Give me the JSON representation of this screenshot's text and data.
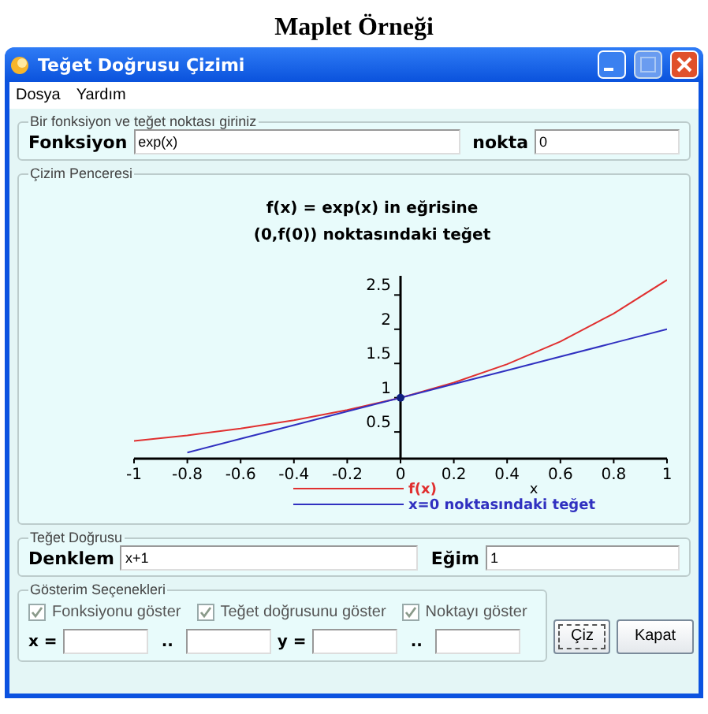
{
  "page_title": "Maplet Örneği",
  "window": {
    "title": "Teğet Doğrusu Çizimi"
  },
  "menu": [
    "Dosya",
    "Yardım"
  ],
  "input_group": {
    "title": "Bir fonksiyon ve teğet noktası  giriniz",
    "fields": [
      {
        "label": "Fonksiyon",
        "value": "exp(x)"
      },
      {
        "label": "nokta",
        "value": "0"
      }
    ]
  },
  "plot_group": {
    "title": "Çizim Penceresi",
    "chart_data": {
      "type": "line",
      "title": "f(x) = exp(x) in eğrisine\n(0,f(0)) noktasındaki teğet",
      "xlabel": "x",
      "x": [
        -1,
        -0.8,
        -0.6,
        -0.4,
        -0.2,
        0,
        0.2,
        0.4,
        0.6,
        0.8,
        1
      ],
      "series": [
        {
          "name": "f(x)",
          "color": "#e03030",
          "values": [
            0.37,
            0.45,
            0.55,
            0.67,
            0.82,
            1,
            1.22,
            1.49,
            1.82,
            2.23,
            2.72
          ]
        },
        {
          "name": "x=0 noktasındaki teğet",
          "color": "#3030c0",
          "values": [
            null,
            0.2,
            0.4,
            0.6,
            0.8,
            1,
            1.2,
            1.4,
            1.6,
            1.8,
            2
          ]
        }
      ],
      "xlim": [
        -1,
        1
      ],
      "ylim": [
        0.11,
        2.78
      ],
      "xticks": [
        -1,
        -0.8,
        -0.6,
        -0.4,
        -0.2,
        0,
        0.2,
        0.4,
        0.6,
        0.8,
        1
      ],
      "yticks": [
        0.5,
        1,
        1.5,
        2,
        2.5
      ]
    }
  },
  "tangent_group": {
    "title": "Teğet Doğrusu",
    "fields": [
      {
        "label": "Denklem",
        "value": "x+1"
      },
      {
        "label": "Eğim",
        "value": "1"
      }
    ]
  },
  "options_group": {
    "title": "Gösterim Seçenekleri",
    "checkboxes": [
      {
        "label": "Fonksiyonu göster",
        "checked": true
      },
      {
        "label": "Teğet doğrusunu göster",
        "checked": true
      },
      {
        "label": "Noktayı göster",
        "checked": true
      }
    ],
    "ranges": [
      {
        "label": "x =",
        "separator": ".."
      },
      {
        "label": "y =",
        "separator": ".."
      }
    ]
  },
  "buttons": [
    {
      "label": "Çiz",
      "focused": true
    },
    {
      "label": "Kapat",
      "focused": false
    }
  ]
}
